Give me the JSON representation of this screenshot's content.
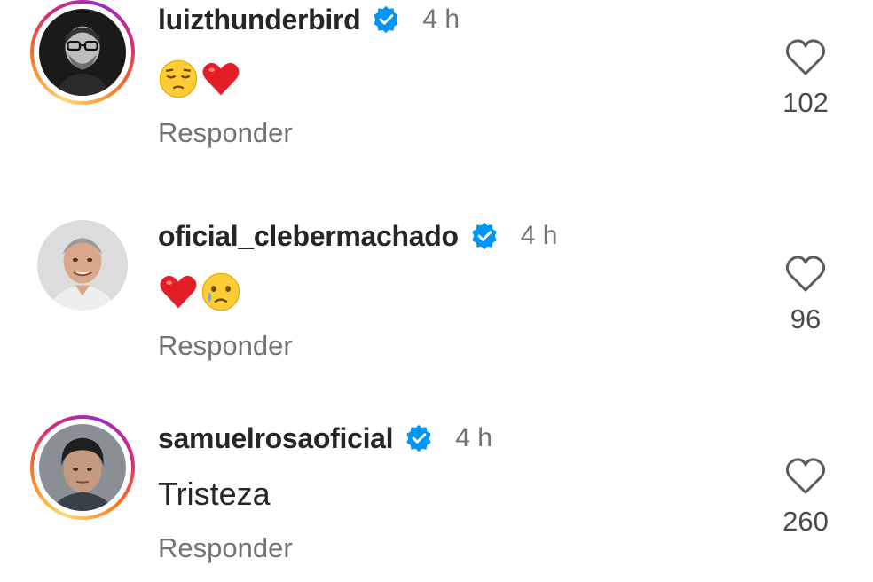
{
  "comments": [
    {
      "username": "luizthunderbird",
      "verified": true,
      "time": "4 h",
      "text": "",
      "emojis": [
        "pensive-face",
        "red-heart"
      ],
      "reply_label": "Responder",
      "likes": "102",
      "story_ring": true
    },
    {
      "username": "oficial_clebermachado",
      "verified": true,
      "time": "4 h",
      "text": "",
      "emojis": [
        "red-heart",
        "crying-face"
      ],
      "reply_label": "Responder",
      "likes": "96",
      "story_ring": false
    },
    {
      "username": "samuelrosaoficial",
      "verified": true,
      "time": "4 h",
      "text": "Tristeza",
      "emojis": [],
      "reply_label": "Responder",
      "likes": "260",
      "story_ring": true
    }
  ],
  "colors": {
    "verified_blue": "#0095f6",
    "secondary_text": "#737373",
    "primary_text": "#262626"
  }
}
